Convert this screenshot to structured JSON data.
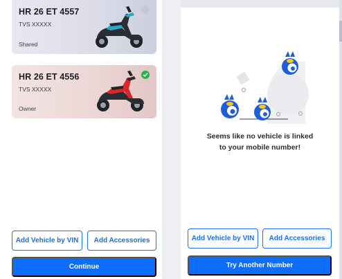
{
  "left_screen": {
    "vehicles": [
      {
        "registration": "HR 26 ET 4557",
        "model": "TVS XXXXX",
        "role": "Shared",
        "selected": false,
        "accent_color": "#29a6c9"
      },
      {
        "registration": "HR 26 ET 4556",
        "model": "TVS XXXXX",
        "role": "Owner",
        "selected": true,
        "accent_color": "#d8282b"
      }
    ],
    "add_vin_label": "Add Vehicle by VIN",
    "add_accessories_label": "Add Accessories",
    "continue_label": "Continue"
  },
  "right_screen": {
    "empty_message_line1": "Seems like no vehicle is linked",
    "empty_message_line2": "to your mobile number!",
    "add_vin_label": "Add Vehicle by VIN",
    "add_accessories_label": "Add Accessories",
    "try_another_label": "Try Another Number"
  },
  "colors": {
    "primary": "#0d6efd",
    "success": "#25b44a",
    "mascot": "#1f5fd6"
  }
}
